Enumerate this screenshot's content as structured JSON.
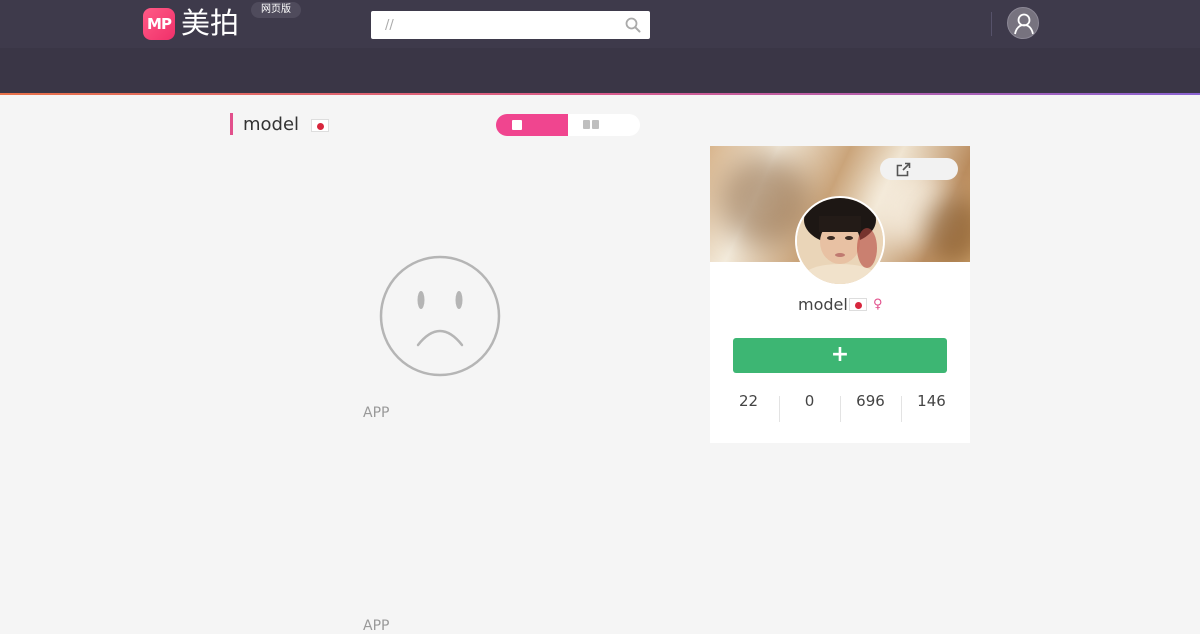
{
  "header": {
    "logo_mark": "MP",
    "logo_text": "美拍",
    "web_badge": "网页版",
    "search_placeholder": "//",
    "icons": [
      "search-icon",
      "user-icon"
    ]
  },
  "main": {
    "title": "model",
    "view_modes": [
      "single-column",
      "double-column"
    ],
    "empty_state": {
      "icon": "sad-face-icon",
      "message": "APP",
      "message_2": "APP"
    }
  },
  "profile": {
    "name": "model",
    "gender_symbol": "♀",
    "follow_label": "+",
    "share_icon": "share-icon",
    "stats": [
      "22",
      "0",
      "696",
      "146"
    ]
  },
  "colors": {
    "header_bg": "#3e3a4b",
    "accent_pink": "#f0458f",
    "follow_green": "#3db673"
  }
}
